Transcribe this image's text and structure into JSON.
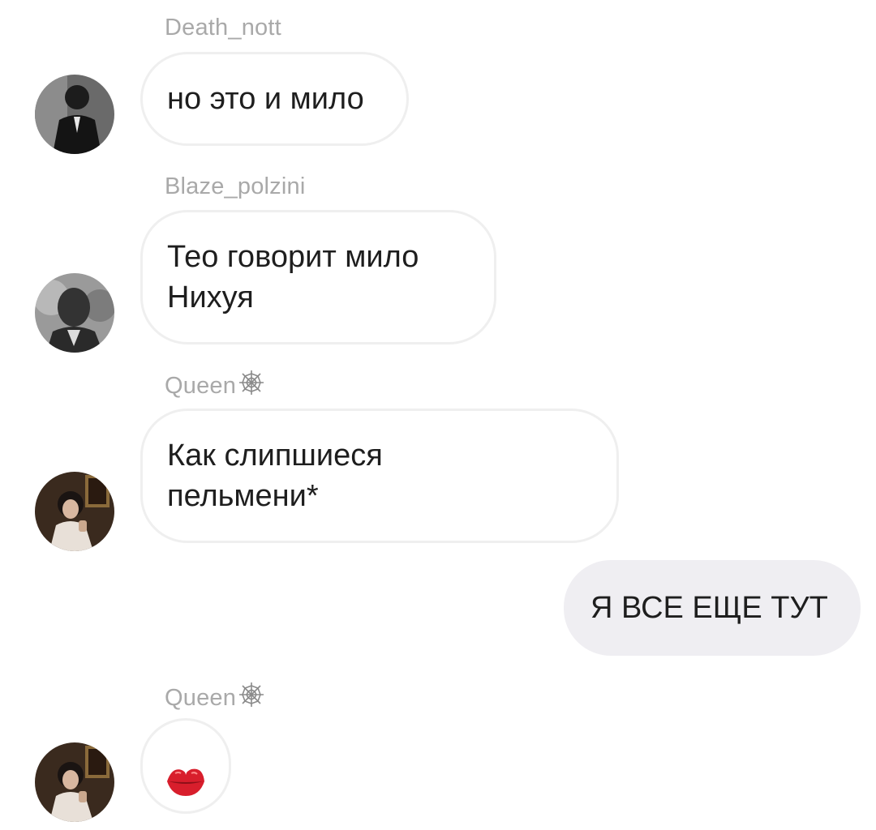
{
  "messages": [
    {
      "sender": "Death_nott",
      "text": "но это и мило"
    },
    {
      "sender": "Blaze_polzini",
      "text": "Тео говорит мило\nНихуя"
    },
    {
      "sender": "Queen",
      "sender_icon": "spider-web-icon",
      "text": "Как слипшиеся\nпельмени*"
    },
    {
      "sender": "",
      "text": "Я ВСЕ ЕЩЕ ТУТ",
      "outgoing": true
    },
    {
      "sender": "Queen",
      "sender_icon": "spider-web-icon",
      "text": "",
      "emoji": "kiss-mark-icon"
    }
  ],
  "colors": {
    "bubble_border": "#efefef",
    "outgoing_bubble": "#efeef2",
    "sender_name": "#a9a9a9",
    "message_text": "#1e1e1e",
    "kiss_mark": "#d81e2c"
  }
}
